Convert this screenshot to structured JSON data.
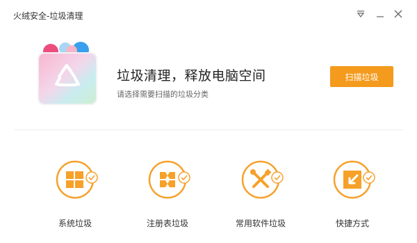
{
  "window": {
    "title": "火绒安全-垃圾清理",
    "controls": [
      "menu-icon",
      "minimize-icon",
      "close-icon"
    ]
  },
  "hero": {
    "icon": "recycle-bin-icon",
    "headline": "垃圾清理，释放电脑空间",
    "subline": "请选择需要扫描的垃圾分类",
    "scan_button": "扫描垃圾"
  },
  "categories": [
    {
      "label": "系统垃圾",
      "icon": "windows-logo-icon",
      "checked": true
    },
    {
      "label": "注册表垃圾",
      "icon": "registry-cubes-icon",
      "checked": true
    },
    {
      "label": "常用软件垃圾",
      "icon": "tools-icon",
      "checked": true
    },
    {
      "label": "快捷方式",
      "icon": "shortcut-arrow-icon",
      "checked": true
    }
  ],
  "colors": {
    "accent": "#f49a1c",
    "icon_ring": "#f6a12a",
    "check_ring": "#f6a12a"
  }
}
